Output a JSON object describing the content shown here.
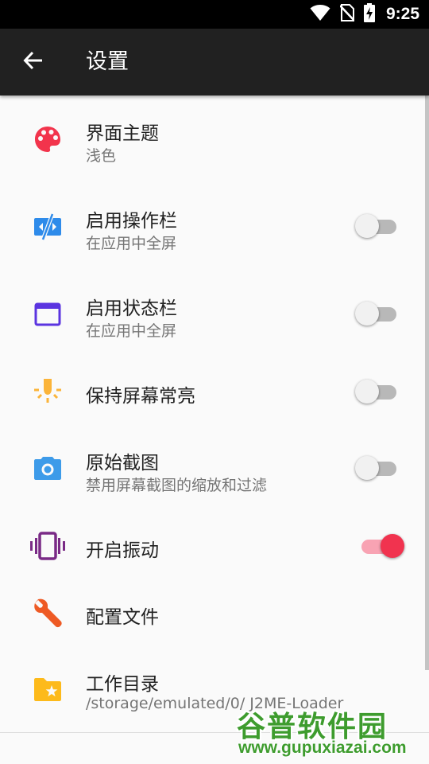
{
  "status_bar": {
    "time": "9:25",
    "icons": [
      "wifi-icon",
      "no-sim-icon",
      "battery-charging-icon"
    ]
  },
  "app_bar": {
    "back_icon": "arrow-left-icon",
    "title": "设置"
  },
  "settings": [
    {
      "id": "theme",
      "icon": "palette-icon",
      "icon_color": "#F2344C",
      "title": "界面主题",
      "summary": "浅色",
      "control": "none"
    },
    {
      "id": "action-bar",
      "icon": "action-bar-off-icon",
      "icon_color": "#2E8BEA",
      "title": "启用操作栏",
      "summary": "在应用中全屏",
      "control": "switch",
      "checked": false
    },
    {
      "id": "status-bar",
      "icon": "window-icon",
      "icon_color": "#5B34E0",
      "title": "启用状态栏",
      "summary": "在应用中全屏",
      "control": "switch",
      "checked": false
    },
    {
      "id": "keep-screen-on",
      "icon": "bulb-icon",
      "icon_color": "#FBB43A",
      "title": "保持屏幕常亮",
      "summary": "",
      "control": "switch",
      "checked": false
    },
    {
      "id": "raw-screenshot",
      "icon": "camera-icon",
      "icon_color": "#3D9BE9",
      "title": "原始截图",
      "summary": "禁用屏幕截图的缩放和过滤",
      "control": "switch",
      "checked": false
    },
    {
      "id": "vibration",
      "icon": "vibration-icon",
      "icon_color": "#7A2A86",
      "title": "开启振动",
      "summary": "",
      "control": "switch",
      "checked": true
    },
    {
      "id": "config-file",
      "icon": "wrench-icon",
      "icon_color": "#EE5A24",
      "title": "配置文件",
      "summary": "",
      "control": "none"
    },
    {
      "id": "working-dir",
      "icon": "folder-star-icon",
      "icon_color": "#FDBA1B",
      "title": "工作目录",
      "summary": "/storage/emulated/0/ J2ME-Loader",
      "control": "none"
    }
  ],
  "colors": {
    "accent": "#F1334F",
    "app_bar": "#212121",
    "background": "#FAFAFA"
  },
  "watermark": {
    "main": "谷普软件园",
    "url": "www.gupuxiazai.com"
  }
}
